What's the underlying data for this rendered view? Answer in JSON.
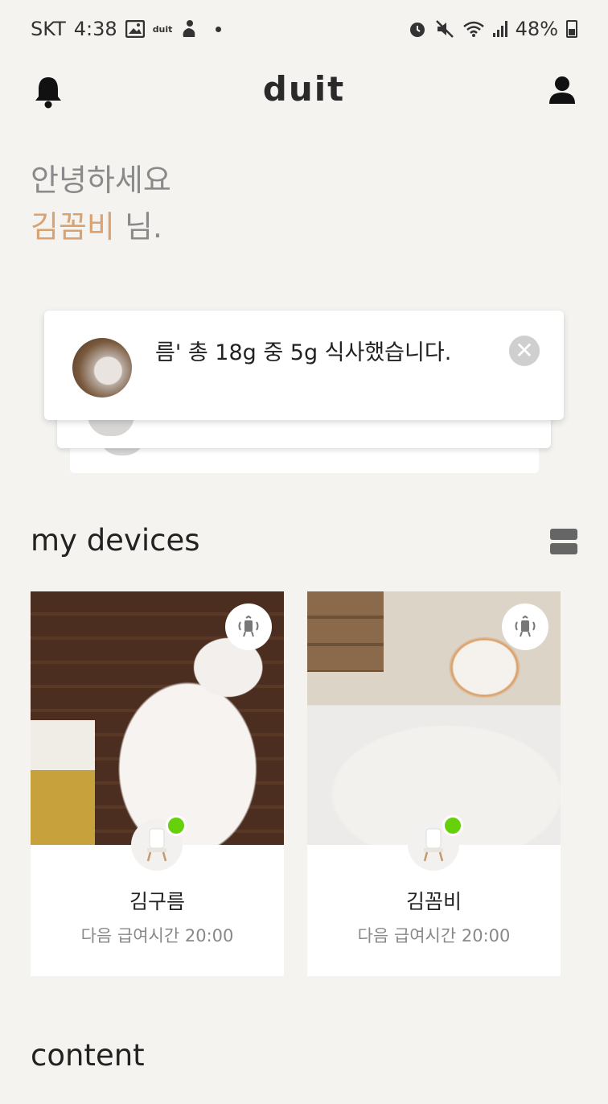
{
  "status_bar": {
    "carrier": "SKT",
    "time": "4:38",
    "app_badge": "duit",
    "battery": "48%"
  },
  "header": {
    "logo": "duit"
  },
  "greeting": {
    "hello": "안녕하세요",
    "user_name": "김꼼비",
    "suffix": " 님."
  },
  "notification": {
    "message": "름' 총 18g 중 5g 식사했습니다."
  },
  "sections": {
    "devices_title": "my devices",
    "content_title": "content"
  },
  "devices": [
    {
      "name": "김구름",
      "next_feeding": "다음 급여시간 20:00",
      "online": true
    },
    {
      "name": "김꼼비",
      "next_feeding": "다음 급여시간 20:00",
      "online": true
    }
  ],
  "colors": {
    "accent": "#d9a273",
    "online": "#66d10a",
    "background": "#f4f3f0"
  }
}
